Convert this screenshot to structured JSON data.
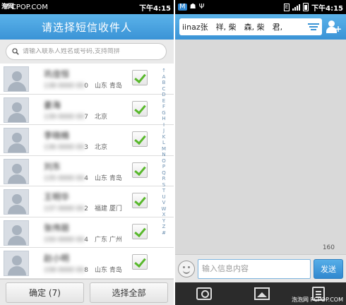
{
  "left": {
    "status": {
      "carrier": "CPOP.COM",
      "time": "下午4:15"
    },
    "watermark": "泡网",
    "title": "请选择短信收件人",
    "search_placeholder": "请输入联系人姓名或号码,支持简拼",
    "contacts": [
      {
        "name": "巩佳恒",
        "number": "0",
        "location": "山东 青岛",
        "checked": true
      },
      {
        "name": "姜海",
        "number": "7",
        "location": "北京",
        "checked": true
      },
      {
        "name": "李晓楠",
        "number": "3",
        "location": "北京",
        "checked": true
      },
      {
        "name": "刘东",
        "number": "4",
        "location": "山东 青岛",
        "checked": true
      },
      {
        "name": "王明华",
        "number": "2",
        "location": "福建 厦门",
        "checked": true
      },
      {
        "name": "张伟丽",
        "number": "4",
        "location": "广东 广州",
        "checked": true
      },
      {
        "name": "赵小明",
        "number": "8",
        "location": "山东 青岛",
        "checked": true
      }
    ],
    "alphabet": [
      "↑",
      "A",
      "B",
      "C",
      "D",
      "E",
      "F",
      "G",
      "H",
      "I",
      "J",
      "K",
      "L",
      "M",
      "N",
      "O",
      "P",
      "Q",
      "R",
      "S",
      "T",
      "U",
      "V",
      "W",
      "X",
      "Y",
      "Z",
      "#"
    ],
    "confirm_label": "确定 (7)",
    "select_all_label": "选择全部"
  },
  "right": {
    "status": {
      "time": "下午4:15"
    },
    "recipients": "iinaz张　祥, 柴　森, 柴　君,",
    "char_count": "160",
    "input_placeholder": "输入信息内容",
    "send_label": "发送",
    "watermark": "泡泡网 PCPOP.COM"
  },
  "colors": {
    "header": "#3a93d6",
    "check": "#58b82b"
  }
}
